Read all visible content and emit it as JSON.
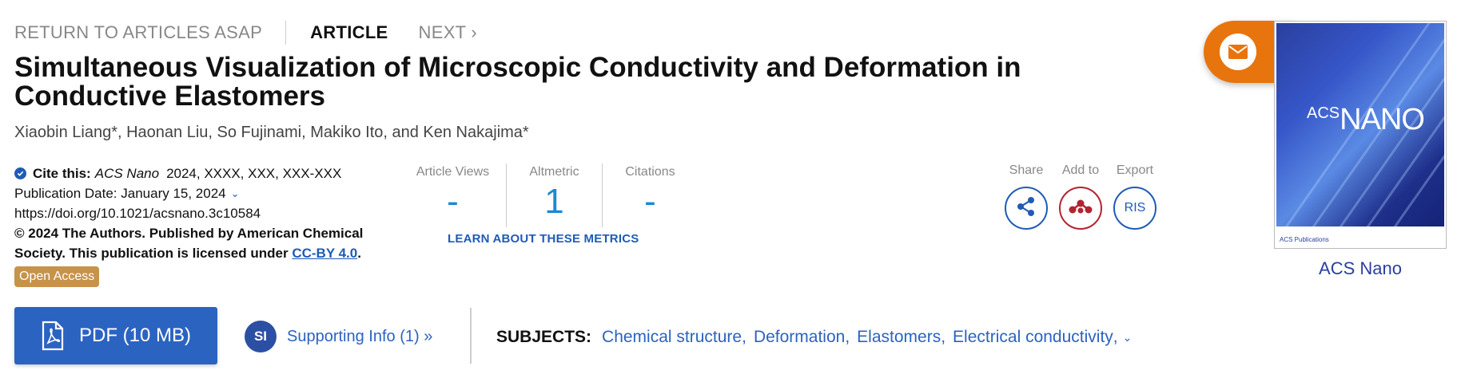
{
  "nav": {
    "return_label": "RETURN TO ARTICLES ASAP",
    "article_label": "ARTICLE",
    "next_label": "NEXT"
  },
  "article": {
    "title": "Simultaneous Visualization of Microscopic Conductivity and Deformation in Conductive Elastomers",
    "authors": "Xiaobin Liang*, Haonan Liu, So Fujinami, Makiko Ito, and Ken Nakajima*"
  },
  "citation": {
    "label": "Cite this:",
    "journal": "ACS Nano",
    "details": "2024, XXXX, XXX, XXX-XXX",
    "pub_date": "Publication Date: January 15, 2024",
    "doi": "https://doi.org/10.1021/acsnano.3c10584",
    "license_text": "© 2024 The Authors. Published by American Chemical Society. This publication is licensed under",
    "license_link": "CC-BY 4.0",
    "license_end": ".",
    "open_access": "Open Access"
  },
  "metrics": {
    "views_label": "Article Views",
    "views_value": "-",
    "altmetric_label": "Altmetric",
    "altmetric_value": "1",
    "citations_label": "Citations",
    "citations_value": "-",
    "learn_label": "LEARN ABOUT THESE METRICS"
  },
  "actions": {
    "share_label": "Share",
    "add_label": "Add to",
    "export_label": "Export",
    "export_button": "RIS"
  },
  "cover": {
    "logo_acs": "ACS",
    "logo_name": "NANO",
    "footer": "ACS Publications",
    "link_label": "ACS Nano"
  },
  "bottom": {
    "pdf_label": "PDF (10 MB)",
    "si_badge": "SI",
    "si_label": "Supporting Info (1) »",
    "subjects_label": "SUBJECTS:",
    "subjects": [
      "Chemical structure",
      "Deformation",
      "Elastomers",
      "Electrical conductivity"
    ]
  },
  "colors": {
    "accent_blue": "#2b63c1",
    "metric_blue": "#1e88d0",
    "email_orange": "#e8740e",
    "open_access_gold": "#c7924a",
    "mendeley_red": "#b3232f"
  }
}
